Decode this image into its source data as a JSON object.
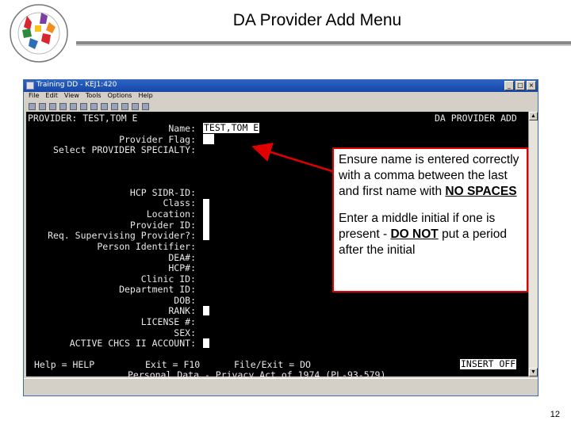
{
  "slide": {
    "title": "DA Provider Add Menu",
    "page_number": "12"
  },
  "window": {
    "title": "Training DD - KEJ1:420",
    "menu": [
      "File",
      "Edit",
      "View",
      "Tools",
      "Options",
      "Help"
    ]
  },
  "terminal": {
    "header_left": "PROVIDER: TEST,TOM E",
    "header_right": "DA PROVIDER ADD",
    "name_label": "Name:",
    "name_value": "TEST,TOM E",
    "fields": [
      "Provider Flag:",
      "Select PROVIDER SPECIALTY:",
      "HCP SIDR-ID:",
      "Class:",
      "Location:",
      "Provider ID:",
      "Req. Supervising Provider?:",
      "Person Identifier:",
      "DEA#:",
      "HCP#:",
      "Clinic ID:",
      "Department ID:",
      "DOB:",
      "RANK:",
      "LICENSE #:",
      "SEX:",
      "ACTIVE CHCS II ACCOUNT:"
    ],
    "footer_help": "Help = HELP",
    "footer_exit": "Exit = F10",
    "footer_file_exit": "File/Exit = DO",
    "footer_mode": "INSERT OFF",
    "footer_privacy": "Personal Data - Privacy Act of 1974 (PL-93-579)"
  },
  "callout": {
    "p1_text": "Ensure name is entered correctly with a comma between the last and first name with ",
    "p1_emphasis": "NO SPACES",
    "p2_text_a": "Enter a middle initial if one is present - ",
    "p2_emphasis": "DO NOT",
    "p2_text_b": " put a period after the initial"
  },
  "colors": {
    "callout_border": "#e00000",
    "arrow": "#e00000",
    "terminal_bg": "#000000",
    "terminal_text": "#e8e8e8"
  }
}
